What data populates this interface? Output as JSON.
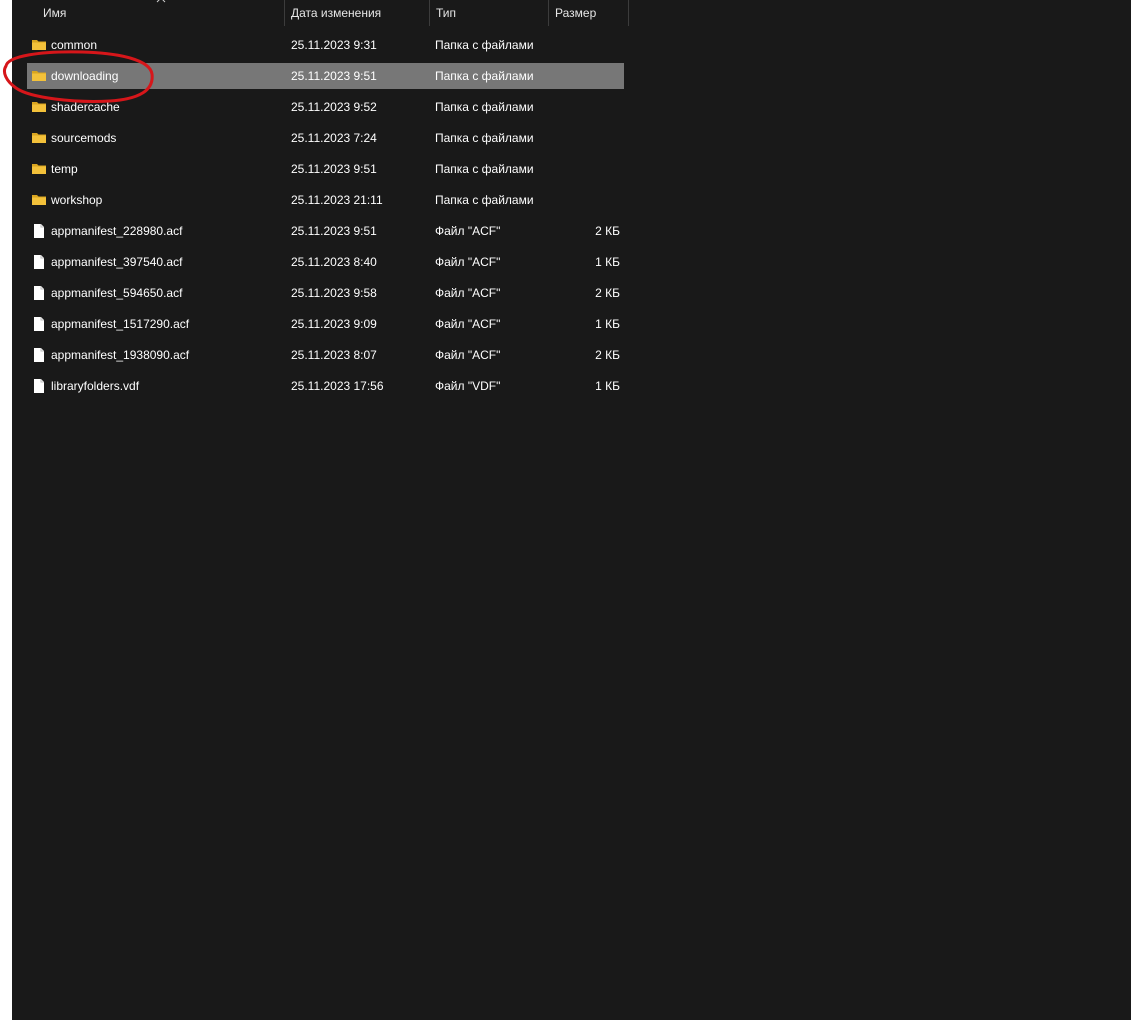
{
  "columns": {
    "name": "Имя",
    "date": "Дата изменения",
    "type": "Тип",
    "size": "Размер"
  },
  "rows": [
    {
      "name": "common",
      "date": "25.11.2023 9:31",
      "type": "Папка с файлами",
      "size": "",
      "icon": "folder-icon"
    },
    {
      "name": "downloading",
      "date": "25.11.2023 9:51",
      "type": "Папка с файлами",
      "size": "",
      "icon": "folder-icon",
      "selected": true
    },
    {
      "name": "shadercache",
      "date": "25.11.2023 9:52",
      "type": "Папка с файлами",
      "size": "",
      "icon": "folder-icon"
    },
    {
      "name": "sourcemods",
      "date": "25.11.2023 7:24",
      "type": "Папка с файлами",
      "size": "",
      "icon": "folder-icon"
    },
    {
      "name": "temp",
      "date": "25.11.2023 9:51",
      "type": "Папка с файлами",
      "size": "",
      "icon": "folder-icon"
    },
    {
      "name": "workshop",
      "date": "25.11.2023 21:11",
      "type": "Папка с файлами",
      "size": "",
      "icon": "folder-icon"
    },
    {
      "name": "appmanifest_228980.acf",
      "date": "25.11.2023 9:51",
      "type": "Файл \"ACF\"",
      "size": "2 КБ",
      "icon": "file-icon"
    },
    {
      "name": "appmanifest_397540.acf",
      "date": "25.11.2023 8:40",
      "type": "Файл \"ACF\"",
      "size": "1 КБ",
      "icon": "file-icon"
    },
    {
      "name": "appmanifest_594650.acf",
      "date": "25.11.2023 9:58",
      "type": "Файл \"ACF\"",
      "size": "2 КБ",
      "icon": "file-icon"
    },
    {
      "name": "appmanifest_1517290.acf",
      "date": "25.11.2023 9:09",
      "type": "Файл \"ACF\"",
      "size": "1 КБ",
      "icon": "file-icon"
    },
    {
      "name": "appmanifest_1938090.acf",
      "date": "25.11.2023 8:07",
      "type": "Файл \"ACF\"",
      "size": "2 КБ",
      "icon": "file-icon"
    },
    {
      "name": "libraryfolders.vdf",
      "date": "25.11.2023 17:56",
      "type": "Файл \"VDF\"",
      "size": "1 КБ",
      "icon": "file-icon"
    }
  ],
  "colors": {
    "background": "#191919",
    "selection": "#777777",
    "folder": "#f3c13a",
    "annotation": "#d6161a"
  }
}
